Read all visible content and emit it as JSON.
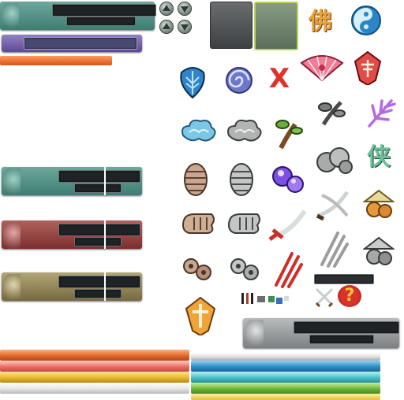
{
  "colors": {
    "teal": "#4f8f83",
    "purple": "#6a56a0",
    "red": "#8a3a3a",
    "khaki": "#8c7f57",
    "gray": "#8a8e90",
    "slot_dark": "#1f2326",
    "orange_bar": "#e06a2a",
    "pink_bar": "#ec6f69",
    "yellow_bar": "#e8b931",
    "white_bar": "#e6e6e6",
    "blue_bar": "#2f8ec6",
    "cyan_bar": "#48c1c9",
    "green_bar": "#6fb63b",
    "gold_bar": "#e4bf3b"
  },
  "icons": {
    "buddha_glyph": "佛",
    "hero_glyph": "侠",
    "cross_glyph": "X",
    "question_glyph": "?"
  },
  "icon_names": [
    "yin-yang-icon",
    "blue-feather-mask-icon",
    "spiral-wind-icon",
    "fan-icon",
    "red-crest-icon",
    "blue-cloud-icon",
    "gray-cloud-icon",
    "herb-root-icon",
    "gray-herb-icon",
    "purple-feather-icon",
    "bone-armor-icon",
    "gray-bone-armor-icon",
    "purple-orb-icon",
    "gray-smoke-icon",
    "fist-icon",
    "gray-fist-icon",
    "red-sword-icon",
    "twin-sabre-icon",
    "gourd-icon",
    "bone-gear-icon",
    "gray-bone-gear-icon",
    "claw-slash-icon",
    "gray-claw-slash-icon",
    "gray-gourd-icon",
    "golden-emblem-icon",
    "crossed-swords-icon",
    "help-icon"
  ]
}
